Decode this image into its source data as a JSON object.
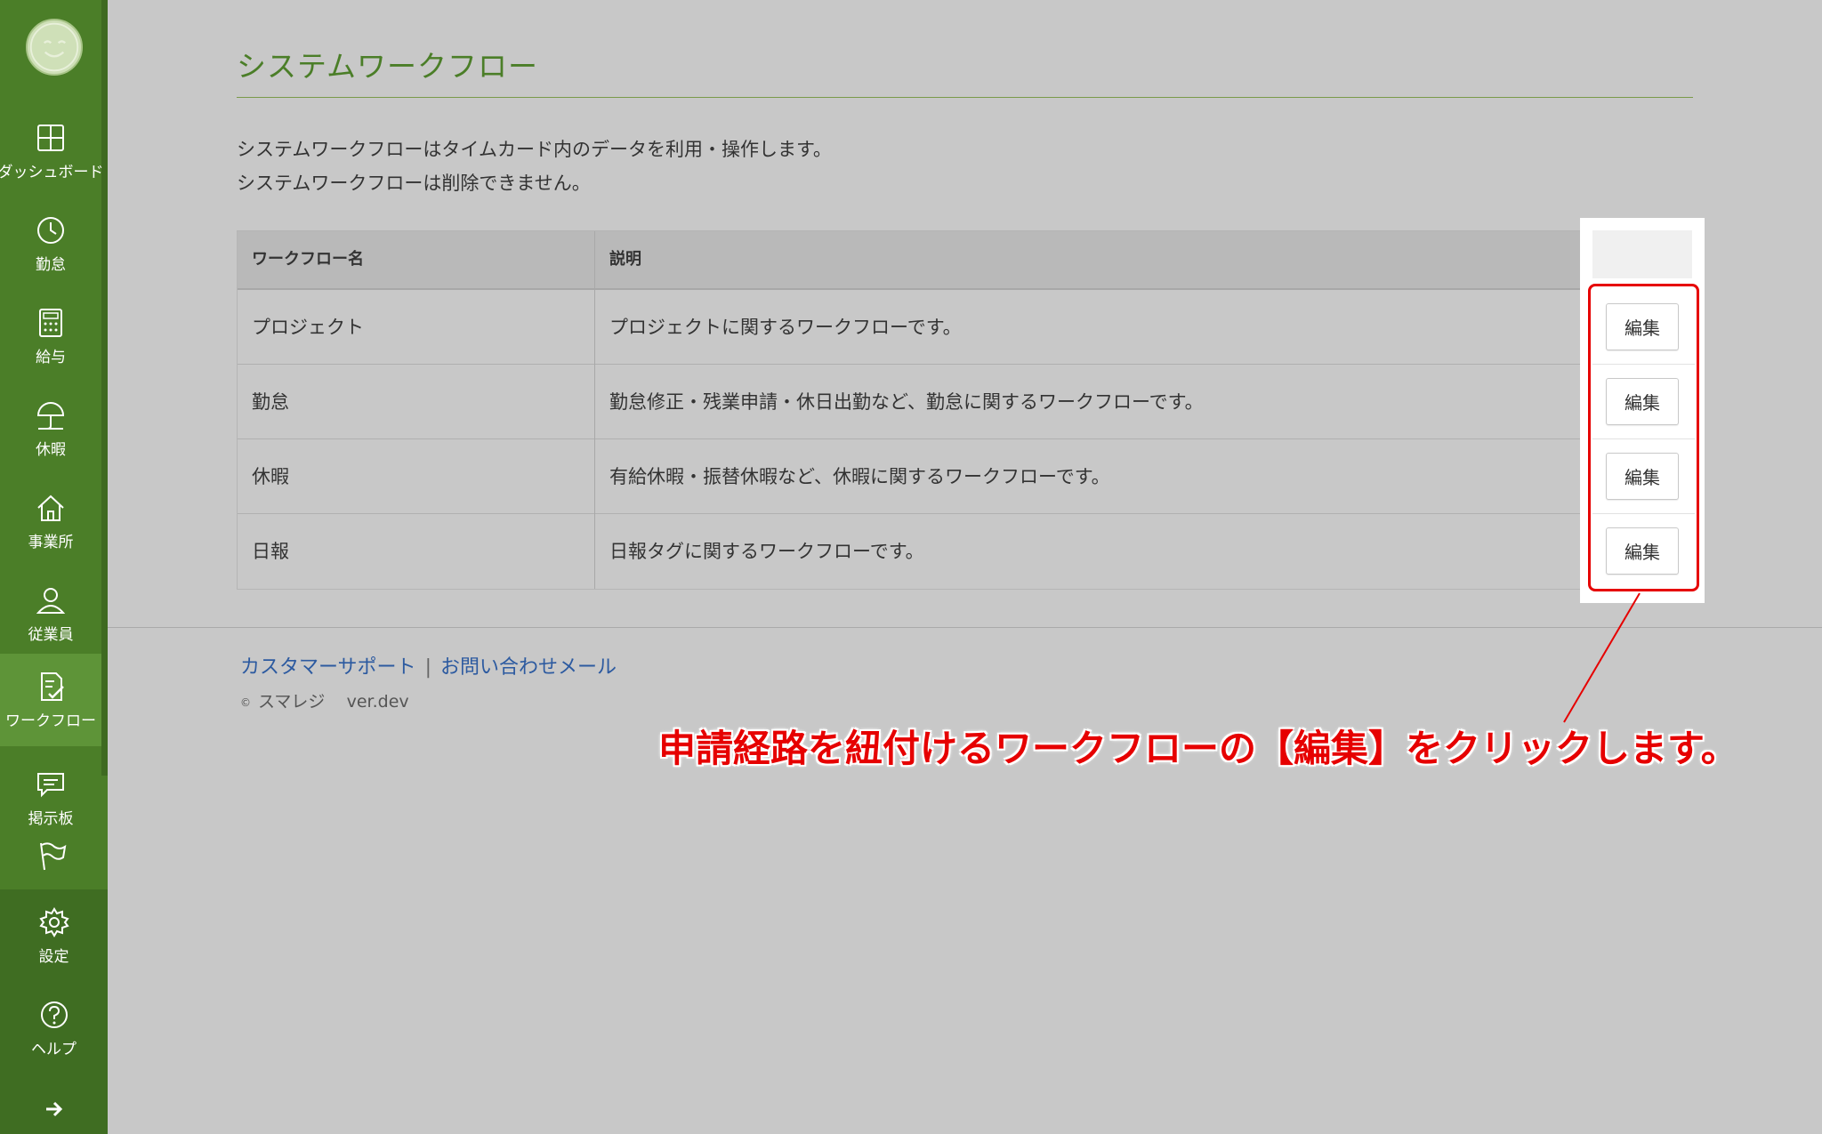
{
  "sidebar": {
    "items": [
      {
        "label": "ダッシュボード",
        "icon": "dashboard-icon"
      },
      {
        "label": "勤怠",
        "icon": "clock-icon"
      },
      {
        "label": "給与",
        "icon": "calculator-icon"
      },
      {
        "label": "休暇",
        "icon": "umbrella-icon"
      },
      {
        "label": "事業所",
        "icon": "home-icon"
      },
      {
        "label": "従業員",
        "icon": "person-icon"
      },
      {
        "label": "ワークフロー",
        "icon": "checklist-icon"
      },
      {
        "label": "掲示板",
        "icon": "chat-icon"
      },
      {
        "label": "",
        "icon": "flag-icon"
      }
    ],
    "bottom_items": [
      {
        "label": "設定",
        "icon": "gear-icon"
      },
      {
        "label": "ヘルプ",
        "icon": "help-icon"
      }
    ],
    "active_index": 6
  },
  "main": {
    "title": "システムワークフロー",
    "description": [
      "システムワークフローはタイムカード内のデータを利用・操作します。",
      "システムワークフローは削除できません。"
    ],
    "table": {
      "headers": [
        "ワークフロー名",
        "説明"
      ],
      "rows": [
        {
          "name": "プロジェクト",
          "description": "プロジェクトに関するワークフローです。",
          "action": "編集"
        },
        {
          "name": "勤怠",
          "description": "勤怠修正・残業申請・休日出勤など、勤怠に関するワークフローです。",
          "action": "編集"
        },
        {
          "name": "休暇",
          "description": "有給休暇・振替休暇など、休暇に関するワークフローです。",
          "action": "編集"
        },
        {
          "name": "日報",
          "description": "日報タグに関するワークフローです。",
          "action": "編集"
        }
      ]
    }
  },
  "footer": {
    "links": [
      "カスタマーサポート",
      "お問い合わせメール"
    ],
    "separator": "|",
    "copyright_symbol": "©",
    "company": "スマレジ",
    "version": "ver.dev"
  },
  "annotation": {
    "text": "申請経路を紐付けるワークフローの【編集】をクリックします。",
    "color": "#e60000"
  },
  "colors": {
    "sidebar": "#4b7e28",
    "sidebar_active": "#5e9438",
    "title": "#4b7e28",
    "link": "#2c5aa0",
    "highlight": "#e60000"
  }
}
